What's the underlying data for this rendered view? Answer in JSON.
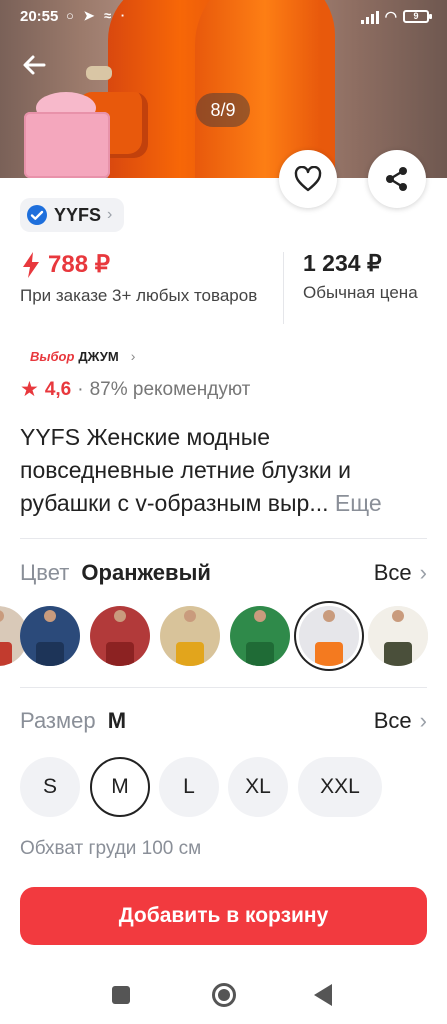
{
  "status_bar": {
    "time": "20:55",
    "notif_icons": "○ ➤ ≈ ·",
    "battery": "9"
  },
  "gallery": {
    "counter": "8/9"
  },
  "brand": {
    "name": "YYFS"
  },
  "price": {
    "promo": "788 ₽",
    "promo_note": "При заказе 3+ любых товаров",
    "regular": "1 234 ₽",
    "regular_note": "Обычная цена"
  },
  "choice_badge": {
    "left": "Выбор",
    "right": "ДЖУМ"
  },
  "rating": {
    "value": "4,6",
    "recommend": "87% рекомендуют"
  },
  "product": {
    "title": "YYFS Женские модные повседневные летние блузки и рубашки с v-образным выр...",
    "more": "Еще"
  },
  "color": {
    "label": "Цвет",
    "selected": "Оранжевый",
    "all": "Все",
    "swatches": [
      {
        "top": "#d9c9b8",
        "bottom": "#c23b2e",
        "selected": false
      },
      {
        "top": "#2b4a7a",
        "bottom": "#1d3458",
        "selected": false
      },
      {
        "top": "#b23a3a",
        "bottom": "#8c2222",
        "selected": false
      },
      {
        "top": "#d8c39a",
        "bottom": "#e2a51c",
        "selected": false
      },
      {
        "top": "#2f8a4a",
        "bottom": "#1f6b36",
        "selected": false
      },
      {
        "top": "#e6e6ea",
        "bottom": "#f47a1f",
        "selected": true
      },
      {
        "top": "#f2efe8",
        "bottom": "#4a4f3a",
        "selected": false
      }
    ]
  },
  "size": {
    "label": "Размер",
    "selected": "M",
    "all": "Все",
    "options": [
      {
        "label": "S",
        "selected": false
      },
      {
        "label": "M",
        "selected": true
      },
      {
        "label": "L",
        "selected": false
      },
      {
        "label": "XL",
        "selected": false
      },
      {
        "label": "XXL",
        "selected": false
      }
    ],
    "bust_note": "Обхват груди 100 см"
  },
  "cart": {
    "button_label": "Добавить в корзину",
    "color": "#f23a3f"
  },
  "accent": "#e8383d"
}
